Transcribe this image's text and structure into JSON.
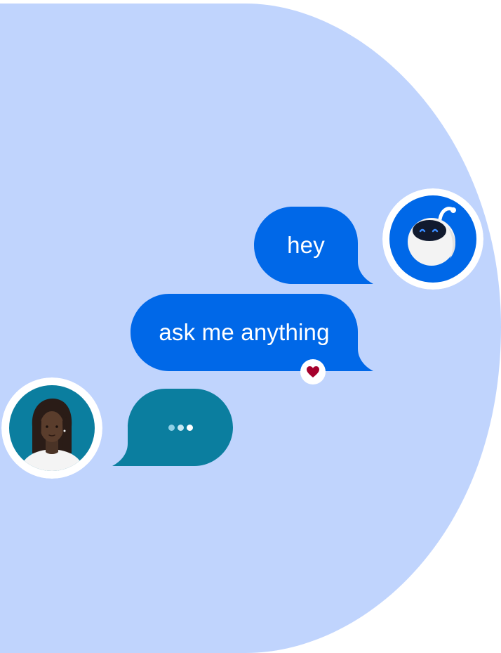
{
  "colors": {
    "background": "#ffffff",
    "blob": "#c0d4fd",
    "bot_bubble": "#0068e8",
    "user_bubble": "#0b7e9f",
    "heart": "#a5002c",
    "avatar_ring": "#ffffff"
  },
  "chat": {
    "messages": [
      {
        "sender": "bot",
        "text": "hey"
      },
      {
        "sender": "bot",
        "text": "ask me anything",
        "reaction": "heart-icon"
      }
    ],
    "typing_indicator": {
      "sender": "user",
      "dots": 3
    }
  },
  "avatars": {
    "bot": {
      "icon": "robot-icon"
    },
    "user": {
      "icon": "person-icon"
    }
  }
}
